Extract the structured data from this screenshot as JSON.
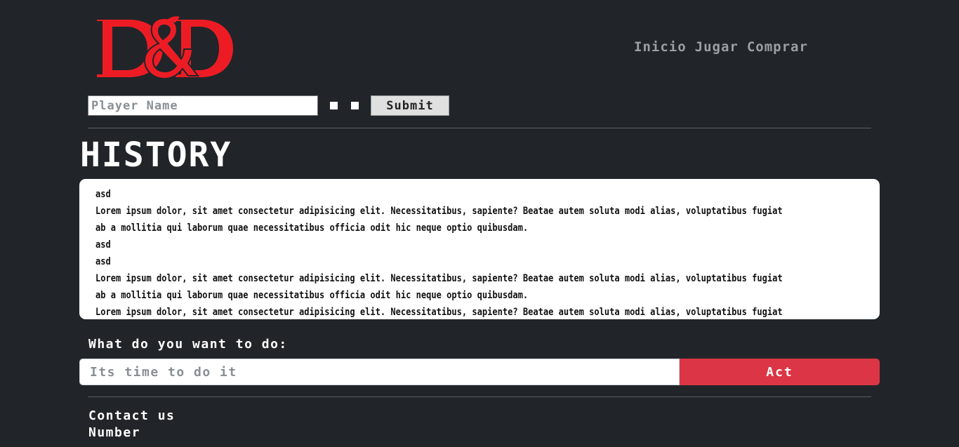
{
  "brand": {
    "logo_text": "D&D",
    "logo_color": "#ed1c24"
  },
  "nav": {
    "items": [
      {
        "label": "Inicio"
      },
      {
        "label": "Jugar"
      },
      {
        "label": "Comprar"
      }
    ]
  },
  "player_form": {
    "name_placeholder": "Player Name",
    "name_value": "",
    "submit_label": "Submit"
  },
  "history": {
    "title": "HISTORY",
    "lines": [
      "asd",
      "Lorem ipsum dolor, sit amet consectetur adipisicing elit. Necessitatibus, sapiente? Beatae autem soluta modi alias, voluptatibus fugiat",
      "ab a mollitia qui laborum quae necessitatibus officia odit hic neque optio quibusdam.",
      "asd",
      "asd",
      "Lorem ipsum dolor, sit amet consectetur adipisicing elit. Necessitatibus, sapiente? Beatae autem soluta modi alias, voluptatibus fugiat",
      "ab a mollitia qui laborum quae necessitatibus officia odit hic neque optio quibusdam.",
      "Lorem ipsum dolor, sit amet consectetur adipisicing elit. Necessitatibus, sapiente? Beatae autem soluta modi alias, voluptatibus fugiat"
    ]
  },
  "action": {
    "label": "What do you want to do:",
    "placeholder": "Its time to do it",
    "value": "",
    "button_label": "Act",
    "button_color": "#dc3545"
  },
  "footer": {
    "contact_label": "Contact us",
    "number_label": "Number"
  },
  "theme": {
    "background": "#212529",
    "nav_text": "#9aa0a6"
  }
}
